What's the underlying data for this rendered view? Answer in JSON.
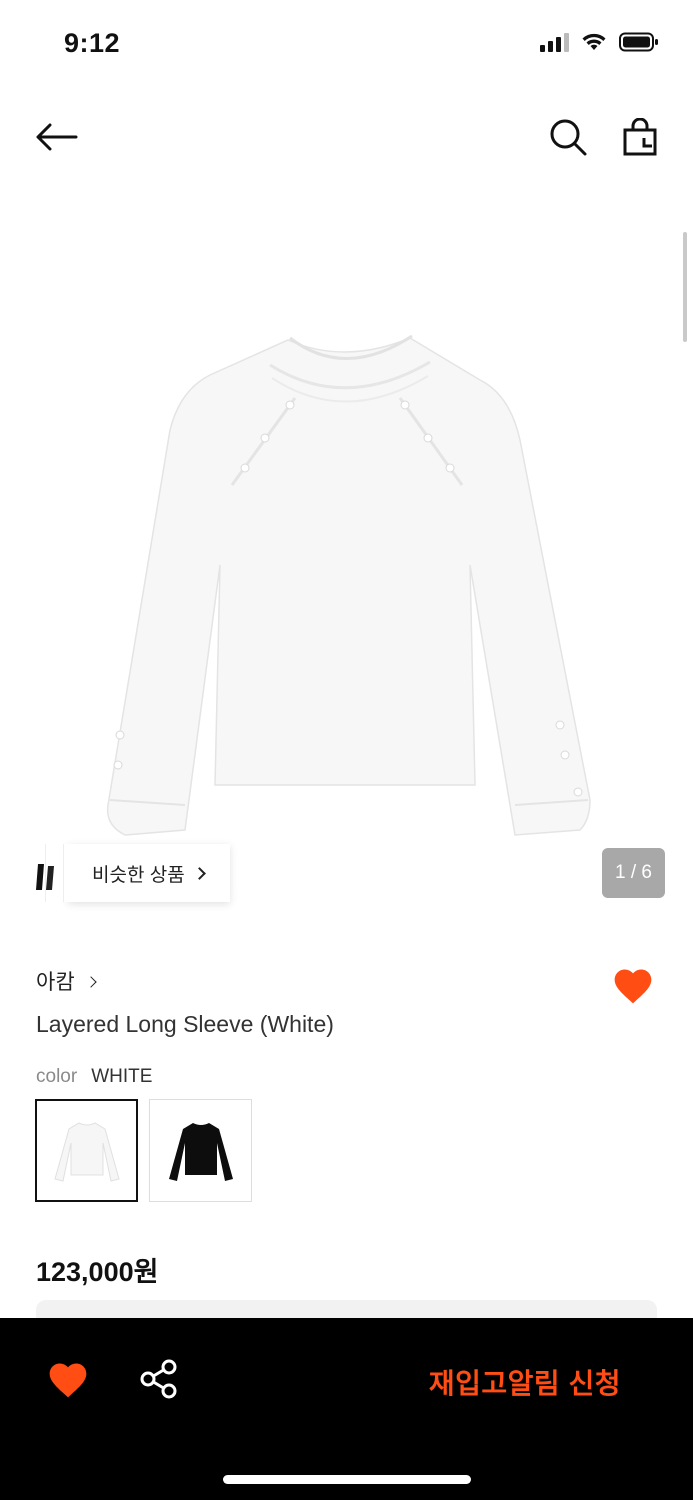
{
  "status_bar": {
    "time": "9:12",
    "icons": [
      "signal-icon",
      "wifi-icon",
      "battery-icon"
    ]
  },
  "header": {
    "icons": [
      "back-arrow-icon",
      "search-icon",
      "shopping-bag-icon"
    ]
  },
  "gallery": {
    "similar_label": "비슷한 상품",
    "counter": "1 / 6",
    "current_page": 1,
    "total_pages": 6
  },
  "product": {
    "brand": "아캄",
    "name": "Layered Long Sleeve (White)",
    "color_label": "color",
    "color_value": "WHITE",
    "swatches": [
      {
        "name": "white",
        "selected": true
      },
      {
        "name": "black",
        "selected": false
      }
    ],
    "price": "123,000원",
    "wishlisted": true
  },
  "bottom_bar": {
    "restock_label": "재입고알림 신청",
    "icons": [
      "heart-icon",
      "share-icon"
    ]
  },
  "colors": {
    "accent": "#ff4d14",
    "bottom_bar_bg": "#000000",
    "counter_bg": "#a8a8a8"
  }
}
